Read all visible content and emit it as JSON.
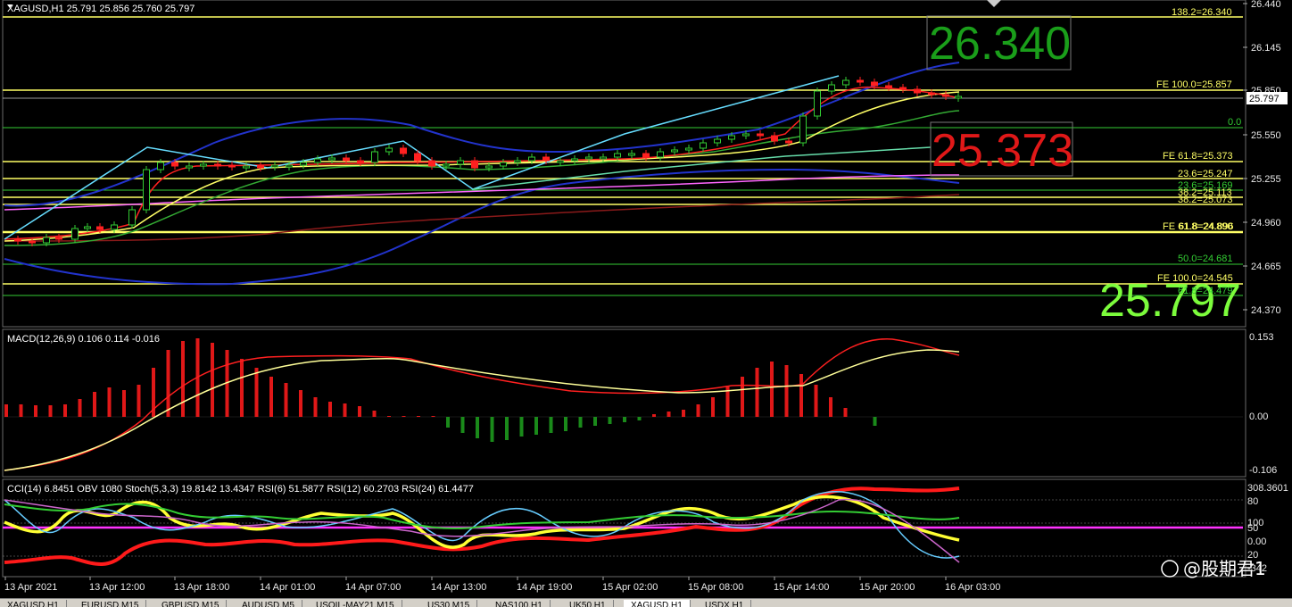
{
  "header": {
    "symbol_info": "XAGUSD,H1  25.791 25.856 25.760 25.797",
    "macd_info": "MACD(12,26,9) 0.106 0.114 -0.016",
    "osc_info": "CCI(14) 6.8451  OBV 1080  Stoch(5,3,3) 19.8142 13.4347  RSI(6) 51.5877  RSI(12) 60.2703  RSI(24) 61.4477"
  },
  "price_axis": [
    "26.440",
    "26.145",
    "25.850",
    "25.550",
    "25.255",
    "24.960",
    "24.665",
    "24.370"
  ],
  "current_price": "25.797",
  "macd_axis": [
    "0.153",
    "0.00",
    "-0.106"
  ],
  "osc_axis": [
    "308.3601",
    "80",
    "100",
    "50",
    "0.00",
    "20",
    "-342"
  ],
  "time_axis": [
    "13 Apr 2021",
    "13 Apr 12:00",
    "13 Apr 18:00",
    "14 Apr 01:00",
    "14 Apr 07:00",
    "14 Apr 13:00",
    "14 Apr 19:00",
    "15 Apr 02:00",
    "15 Apr 08:00",
    "15 Apr 14:00",
    "15 Apr 20:00",
    "16 Apr 03:00"
  ],
  "fib_levels": [
    {
      "text": "138.2=26.340",
      "color": "#ffff66"
    },
    {
      "text": "FE 100.0=25.857",
      "color": "#ffff66"
    },
    {
      "text": "0.0",
      "color": "#33cc33"
    },
    {
      "text": "FE 61.8=25.373",
      "color": "#ffff66"
    },
    {
      "text": "23.6=25.247",
      "color": "#ffff66"
    },
    {
      "text": "23.6=25.169",
      "color": "#33cc33"
    },
    {
      "text": "38.2=25.113",
      "color": "#ffff66"
    },
    {
      "text": "38.2=25.073",
      "color": "#ffff66"
    },
    {
      "text": "FE 61.8=24.890",
      "color": "#ffff66"
    },
    {
      "text": "61.8=24.896",
      "color": "#ffff66"
    },
    {
      "text": "50.0=24.681",
      "color": "#33cc33"
    },
    {
      "text": "FE 100.0=24.545",
      "color": "#ffff66"
    },
    {
      "text": "61.8=24.479",
      "color": "#33cc33"
    }
  ],
  "big_labels": {
    "target_high": "26.340",
    "target_low": "25.373",
    "last_price": "25.797"
  },
  "watermark": "@股期君1",
  "tabs": [
    "XAGUSD,H1",
    "EURUSD,M15",
    "GBPUSD,M15",
    "AUDUSD,M5",
    "USOIL-MAY21,M15",
    "US30,M15",
    "NAS100,H1",
    "UK50,H1",
    "XAGUSD,H1",
    "USDX,H1"
  ],
  "colors": {
    "bull": "#ffffff",
    "bear": "#ff2020",
    "green": "#33cc33",
    "yellow": "#ffff66",
    "magenta": "#ff33ff",
    "cyan": "#66ddff"
  }
}
